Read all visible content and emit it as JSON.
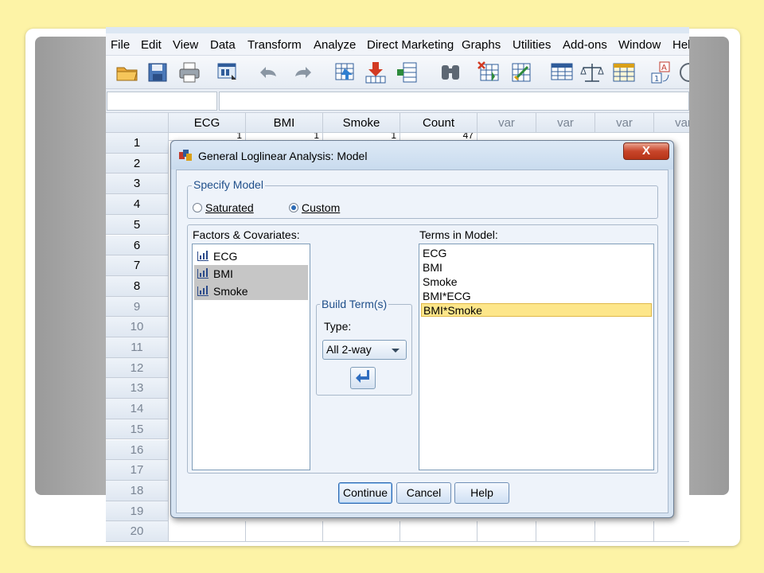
{
  "menu": [
    "File",
    "Edit",
    "View",
    "Data",
    "Transform",
    "Analyze",
    "Direct Marketing",
    "Graphs",
    "Utilities",
    "Add-ons",
    "Window",
    "Hel"
  ],
  "toolbar_icons": [
    "open-folder-icon",
    "save-icon",
    "print-icon",
    "dialog-recall-icon",
    "undo-icon",
    "redo-icon",
    "goto-case-icon",
    "goto-variable-icon",
    "variables-icon",
    "find-icon",
    "insert-cases-icon",
    "insert-variable-icon",
    "split-file-icon",
    "weight-cases-icon",
    "select-cases-icon",
    "value-labels-icon",
    "use-sets-icon"
  ],
  "columns": [
    "ECG",
    "BMI",
    "Smoke",
    "Count",
    "var",
    "var",
    "var",
    "var"
  ],
  "rows": [
    "1",
    "2",
    "3",
    "4",
    "5",
    "6",
    "7",
    "8",
    "9",
    "10",
    "11",
    "12",
    "13",
    "14",
    "15",
    "16",
    "17",
    "18",
    "19",
    "20"
  ],
  "first_row_partial": [
    "1",
    "1",
    "1",
    "47"
  ],
  "dialog": {
    "title": "General Loglinear Analysis: Model",
    "close_label": "X",
    "specify_model": {
      "title": "Specify Model",
      "options": [
        {
          "label": "Saturated",
          "selected": false
        },
        {
          "label": "Custom",
          "selected": true
        }
      ]
    },
    "factors_label": "Factors & Covariates:",
    "factors": [
      {
        "label": "ECG",
        "selected": false
      },
      {
        "label": "BMI",
        "selected": true
      },
      {
        "label": "Smoke",
        "selected": true
      }
    ],
    "build_term": {
      "title": "Build Term(s)",
      "type_label": "Type:",
      "type_value": "All 2-way"
    },
    "terms_label": "Terms in Model:",
    "terms": [
      {
        "label": "ECG",
        "selected": false
      },
      {
        "label": "BMI",
        "selected": false
      },
      {
        "label": "Smoke",
        "selected": false
      },
      {
        "label": "BMI*ECG",
        "selected": false
      },
      {
        "label": "BMI*Smoke",
        "selected": true
      }
    ],
    "buttons": {
      "continue": "Continue",
      "cancel": "Cancel",
      "help": "Help"
    }
  }
}
